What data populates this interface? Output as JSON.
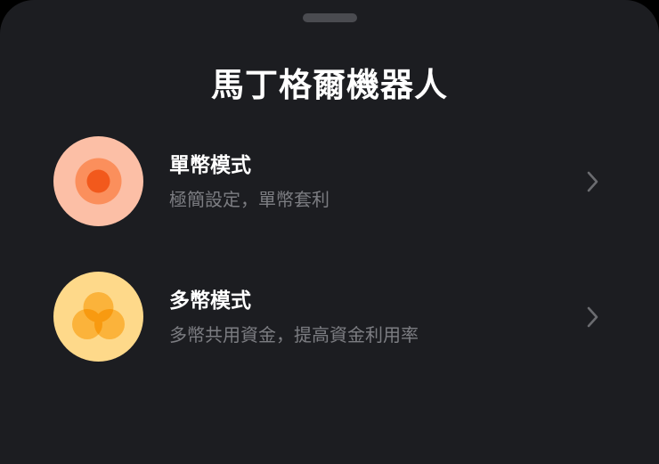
{
  "sheet": {
    "title": "馬丁格爾機器人"
  },
  "modes": [
    {
      "title": "單幣模式",
      "subtitle": "極簡設定，單幣套利",
      "icon": "concentric-circles-icon",
      "colors": {
        "outer": "#fcbfa6",
        "middle": "#fb8f5c",
        "inner": "#f2591c"
      }
    },
    {
      "title": "多幣模式",
      "subtitle": "多幣共用資金，提高資金利用率",
      "icon": "three-coins-icon",
      "colors": {
        "outer": "#fed98a",
        "coin": "#fbb33b",
        "overlap": "#f89a10"
      }
    }
  ],
  "colors": {
    "background": "#1c1d21",
    "title_text": "#ffffff",
    "subtitle_text": "#7c7d82",
    "chevron": "#6b6c70"
  }
}
